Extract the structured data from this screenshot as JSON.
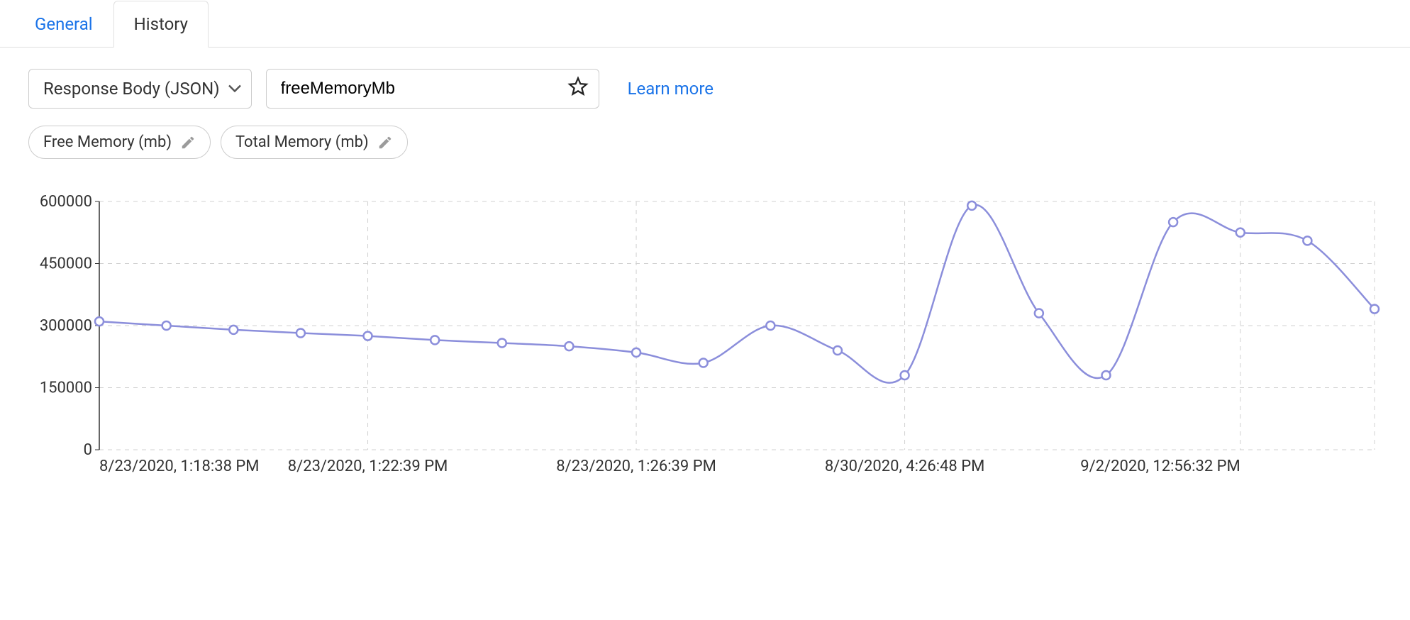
{
  "tabs": [
    {
      "label": "General",
      "active": false
    },
    {
      "label": "History",
      "active": true
    }
  ],
  "controls": {
    "select_value": "Response Body (JSON)",
    "input_value": "freeMemoryMb",
    "learn_more": "Learn more"
  },
  "chips": [
    {
      "label": "Free Memory (mb)"
    },
    {
      "label": "Total Memory (mb)"
    }
  ],
  "chart_data": {
    "type": "line",
    "ylabel": "",
    "xlabel": "",
    "y_ticks": [
      0,
      150000,
      300000,
      450000,
      600000
    ],
    "y_tick_labels": [
      "0",
      "150000",
      "300000",
      "450000",
      "600000"
    ],
    "ylim": [
      0,
      600000
    ],
    "x_tick_labels": [
      "8/23/2020, 1:18:38 PM",
      "8/23/2020, 1:22:39 PM",
      "8/23/2020, 1:26:39 PM",
      "8/30/2020, 4:26:48 PM",
      "9/2/2020, 12:56:32 PM"
    ],
    "x_tick_positions": [
      0,
      4,
      8,
      12,
      17
    ],
    "series": [
      {
        "name": "freeMemoryMb",
        "color": "#8b8edb",
        "values": [
          310000,
          300000,
          290000,
          282000,
          275000,
          265000,
          258000,
          250000,
          235000,
          210000,
          300000,
          240000,
          180000,
          590000,
          330000,
          180000,
          550000,
          525000,
          505000,
          340000
        ]
      }
    ]
  }
}
